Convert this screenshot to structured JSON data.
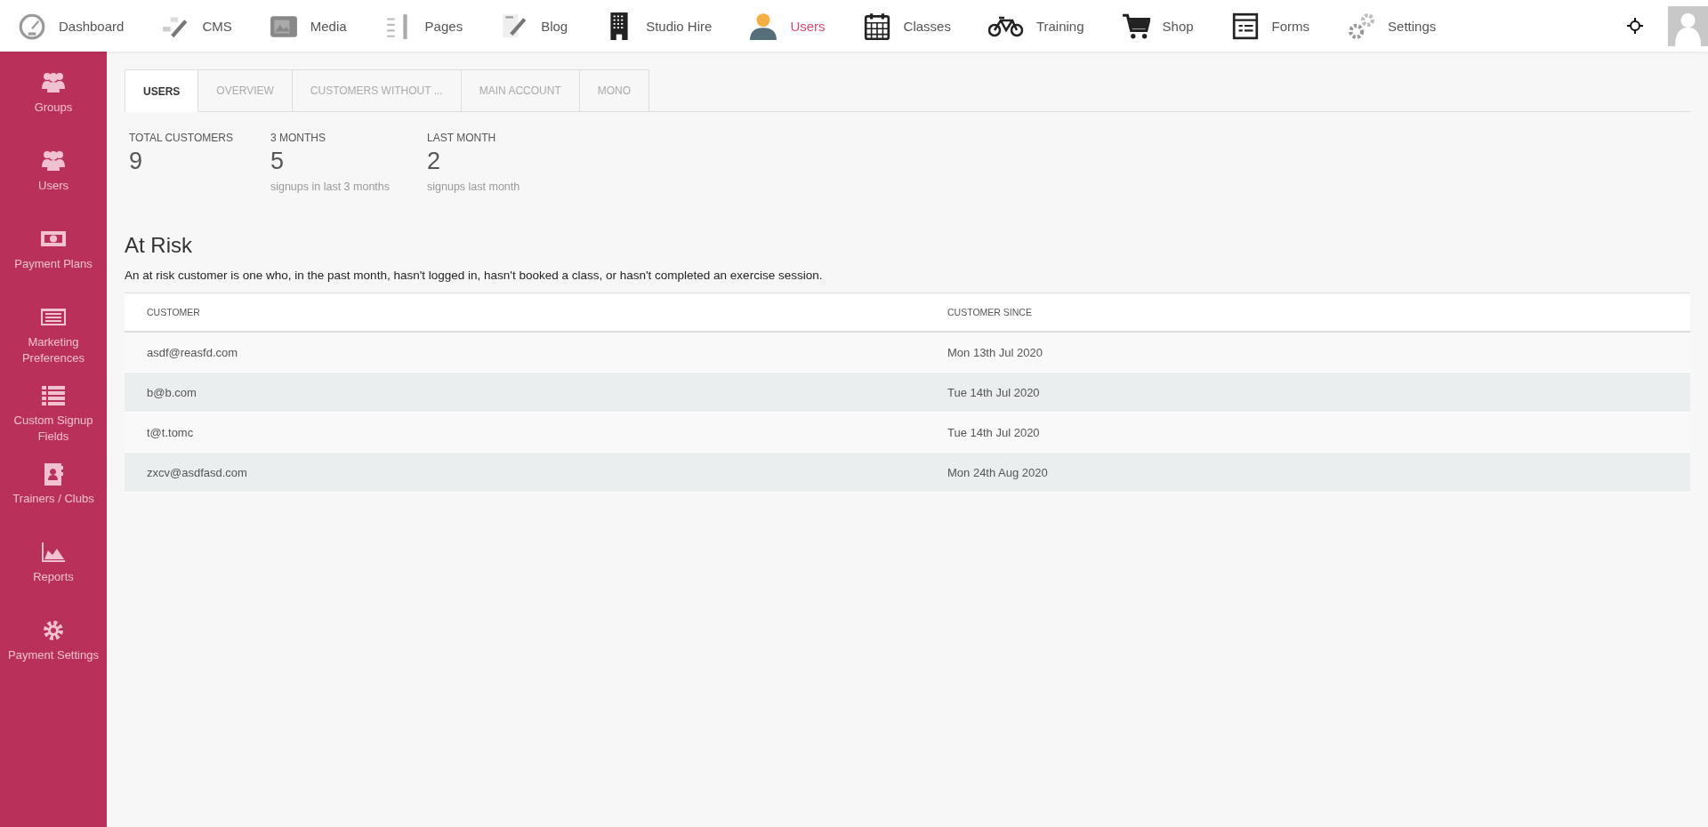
{
  "top_nav": {
    "items": [
      {
        "label": "Dashboard",
        "selected": false
      },
      {
        "label": "CMS",
        "selected": false
      },
      {
        "label": "Media",
        "selected": false
      },
      {
        "label": "Pages",
        "selected": false
      },
      {
        "label": "Blog",
        "selected": false
      },
      {
        "label": "Studio Hire",
        "selected": false
      },
      {
        "label": "Users",
        "selected": true
      },
      {
        "label": "Classes",
        "selected": false
      },
      {
        "label": "Training",
        "selected": false
      },
      {
        "label": "Shop",
        "selected": false
      },
      {
        "label": "Forms",
        "selected": false
      },
      {
        "label": "Settings",
        "selected": false
      }
    ]
  },
  "sidebar": {
    "items": [
      {
        "label": "Groups"
      },
      {
        "label": "Users"
      },
      {
        "label": "Payment Plans"
      },
      {
        "label": "Marketing Preferences"
      },
      {
        "label": "Custom Signup Fields"
      },
      {
        "label": "Trainers / Clubs"
      },
      {
        "label": "Reports"
      },
      {
        "label": "Payment Settings"
      }
    ]
  },
  "tabs": [
    {
      "label": "USERS",
      "selected": true
    },
    {
      "label": "OVERVIEW",
      "selected": false
    },
    {
      "label": "CUSTOMERS WITHOUT ...",
      "selected": false
    },
    {
      "label": "MAIN ACCOUNT",
      "selected": false
    },
    {
      "label": "MONO",
      "selected": false
    }
  ],
  "stats": [
    {
      "label": "TOTAL CUSTOMERS",
      "value": "9"
    },
    {
      "label": "3 MONTHS",
      "value": "5",
      "note": "signups in last 3 months"
    },
    {
      "label": "LAST MONTH",
      "value": "2",
      "note": "signups last month"
    }
  ],
  "at_risk": {
    "title": "At Risk",
    "description": "An at risk customer is one who, in the past month, hasn't logged in, hasn't booked a class, or hasn't completed an exercise session.",
    "table": {
      "columns": [
        "CUSTOMER",
        "CUSTOMER SINCE"
      ],
      "rows": [
        [
          "asdf@reasfd.com",
          "Mon 13th Jul 2020"
        ],
        [
          "b@b.com",
          "Tue 14th Jul 2020"
        ],
        [
          "t@t.tomc",
          "Tue 14th Jul 2020"
        ],
        [
          "zxcv@asdfasd.com",
          "Mon 24th Aug 2020"
        ]
      ]
    }
  }
}
